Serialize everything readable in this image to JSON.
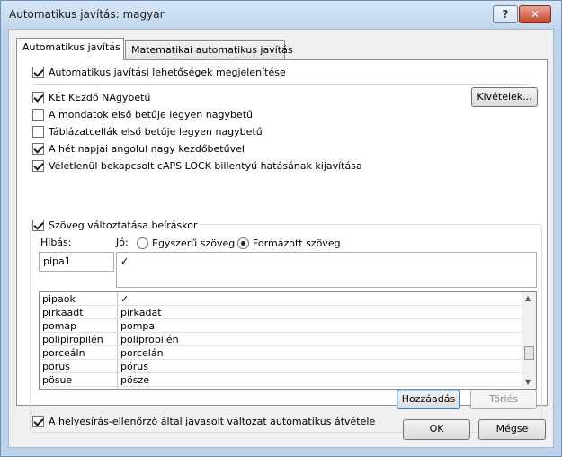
{
  "window": {
    "title": "Automatikus javítás: magyar",
    "help_label": "?",
    "close_label": "✕"
  },
  "tabs": [
    {
      "label": "Automatikus javítás",
      "active": true
    },
    {
      "label": "Matematikai automatikus javítás",
      "active": false
    }
  ],
  "options": {
    "show_buttons": {
      "label": "Automatikus javítási lehetőségek megjelenítése",
      "checked": true
    },
    "two_initials": {
      "label": "KÉt KEzdő NAgybetű",
      "checked": true
    },
    "first_letter_sentence": {
      "label": "A mondatok első betűje legyen nagybetű",
      "checked": false
    },
    "first_letter_table": {
      "label": "Táblázatcellák első betűje legyen nagybetű",
      "checked": false
    },
    "day_names": {
      "label": "A hét napjai angolul nagy kezdőbetűvel",
      "checked": true
    },
    "caps_lock": {
      "label": "Véletlenül bekapcsolt cAPS LOCK billentyű hatásának kijavítása",
      "checked": true
    }
  },
  "exceptions_button": "Kivételek...",
  "replace_group": {
    "enable": {
      "label": "Szöveg változtatása beíráskor",
      "checked": true
    },
    "wrong_label": "Hibás:",
    "right_label": "Jó:",
    "radio_plain": {
      "label": "Egyszerű szöveg",
      "checked": false
    },
    "radio_formatted": {
      "label": "Formázott szöveg",
      "checked": true
    },
    "wrong_value": "pipa1",
    "right_value": "✓"
  },
  "entries": [
    {
      "wrong": "pipaok",
      "right": "✓"
    },
    {
      "wrong": "pirkaadt",
      "right": "pirkadat"
    },
    {
      "wrong": "pomap",
      "right": "pompa"
    },
    {
      "wrong": "polipiropilén",
      "right": "polipropilén"
    },
    {
      "wrong": "porceáln",
      "right": "porcelán"
    },
    {
      "wrong": "porus",
      "right": "pórus"
    },
    {
      "wrong": "pösue",
      "right": "pösze"
    }
  ],
  "add_button": "Hozzáadás",
  "delete_button": "Törlés",
  "spell_checker": {
    "label": "A helyesírás-ellenőrző által javasolt változat automatikus átvétele",
    "checked": true
  },
  "ok_button": "OK",
  "cancel_button": "Mégse"
}
